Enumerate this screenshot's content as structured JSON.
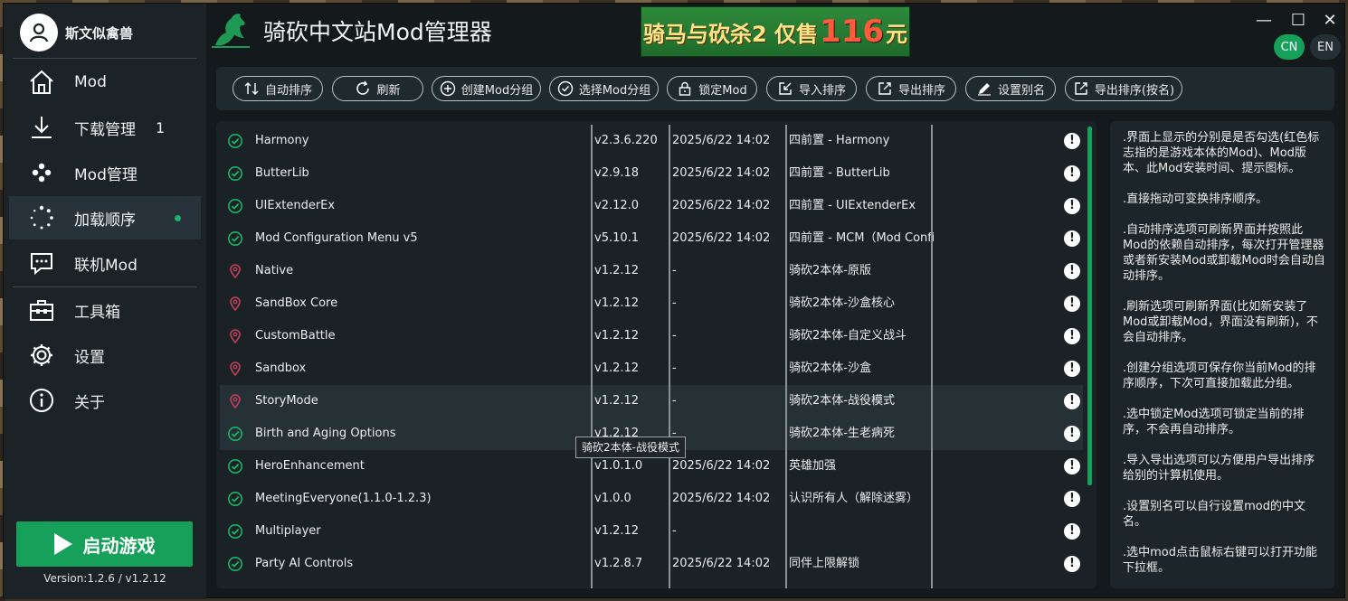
{
  "user": {
    "name": "斯文似禽兽"
  },
  "app": {
    "title": "骑砍中文站Mod管理器",
    "version": "Version:1.2.6 / v1.2.12"
  },
  "banner": {
    "prefix": "骑马与砍杀2 仅售",
    "price": "116",
    "suffix": " 元"
  },
  "window_controls": {
    "minimize": "—",
    "maximize": "☐",
    "close": "✕"
  },
  "language": {
    "cn": "CN",
    "en": "EN",
    "selected": "CN"
  },
  "nav": [
    {
      "label": "Mod",
      "icon": "home-icon"
    },
    {
      "label": "下载管理",
      "count": "1",
      "icon": "download-icon"
    },
    {
      "label": "Mod管理",
      "icon": "dots-icon"
    },
    {
      "label": "加载顺序",
      "icon": "loading-icon",
      "active": true
    },
    {
      "label": "联机Mod",
      "icon": "chat-icon"
    },
    {
      "label": "工具箱",
      "icon": "toolbox-icon"
    },
    {
      "label": "设置",
      "icon": "gear-icon"
    },
    {
      "label": "关于",
      "icon": "info-icon"
    }
  ],
  "launch": {
    "label": "启动游戏"
  },
  "toolbar": [
    {
      "label": "自动排序",
      "icon": "sort-icon"
    },
    {
      "label": "刷新",
      "icon": "refresh-icon"
    },
    {
      "label": "创建Mod分组",
      "icon": "plus-circle-icon"
    },
    {
      "label": "选择Mod分组",
      "icon": "check-circle-icon"
    },
    {
      "label": "锁定Mod",
      "icon": "lock-icon"
    },
    {
      "label": "导入排序",
      "icon": "import-icon"
    },
    {
      "label": "导出排序",
      "icon": "export-icon"
    },
    {
      "label": "设置别名",
      "icon": "pencil-icon"
    },
    {
      "label": "导出排序(按名)",
      "icon": "export-icon"
    }
  ],
  "mods": [
    {
      "name": "Harmony",
      "version": "v2.3.6.220",
      "time": "2025/6/22 14:02",
      "desc": "四前置 - Harmony",
      "type": "check"
    },
    {
      "name": "ButterLib",
      "version": "v2.9.18",
      "time": "2025/6/22 14:02",
      "desc": "四前置 - ButterLib",
      "type": "check"
    },
    {
      "name": "UIExtenderEx",
      "version": "v2.12.0",
      "time": "2025/6/22 14:02",
      "desc": "四前置 - UIExtenderEx",
      "type": "check"
    },
    {
      "name": "Mod Configuration Menu v5",
      "version": "v5.10.1",
      "time": "2025/6/22 14:02",
      "desc": "四前置 - MCM（Mod Config",
      "type": "check"
    },
    {
      "name": "Native",
      "version": "v1.2.12",
      "time": "-",
      "desc": "骑砍2本体-原版",
      "type": "pin"
    },
    {
      "name": "SandBox Core",
      "version": "v1.2.12",
      "time": "-",
      "desc": "骑砍2本体-沙盒核心",
      "type": "pin"
    },
    {
      "name": "CustomBattle",
      "version": "v1.2.12",
      "time": "-",
      "desc": "骑砍2本体-自定义战斗",
      "type": "pin"
    },
    {
      "name": "Sandbox",
      "version": "v1.2.12",
      "time": "-",
      "desc": "骑砍2本体-沙盒",
      "type": "pin"
    },
    {
      "name": "StoryMode",
      "version": "v1.2.12",
      "time": "-",
      "desc": "骑砍2本体-战役模式",
      "type": "pin",
      "highlight": true
    },
    {
      "name": "Birth and Aging Options",
      "version": "v1.2.12",
      "time": "-",
      "desc": "骑砍2本体-生老病死",
      "type": "check",
      "highlight": true
    },
    {
      "name": "HeroEnhancement",
      "version": "v1.0.1.0",
      "time": "2025/6/22 14:02",
      "desc": "英雄加强",
      "type": "check"
    },
    {
      "name": "MeetingEveryone(1.1.0-1.2.3)",
      "version": "v1.0.0",
      "time": "2025/6/22 14:02",
      "desc": "认识所有人（解除迷雾）",
      "type": "check"
    },
    {
      "name": "Multiplayer",
      "version": "v1.2.12",
      "time": "-",
      "desc": "",
      "type": "check"
    },
    {
      "name": "Party AI Controls",
      "version": "v1.2.8.7",
      "time": "2025/6/22 14:02",
      "desc": "同伴上限解锁",
      "type": "check"
    }
  ],
  "tooltip": "骑砍2本体-战役模式",
  "colors": {
    "accent": "#17a05a",
    "pin": "#c0405a"
  },
  "help": [
    ".界面上显示的分别是是否勾选(红色标志指的是游戏本体的Mod)、Mod版本、此Mod安装时间、提示图标。",
    ".直接拖动可变换排序顺序。",
    ".自动排序选项可刷新界面并按照此Mod的依赖自动排序，每次打开管理器或者新安装Mod或卸载Mod时会自动自动排序。",
    ".刷新选项可刷新界面(比如新安装了Mod或卸载Mod，界面没有刷新)，不会自动排序。",
    ".创建分组选项可保存你当前Mod的排序顺序，下次可直接加载此分组。",
    ".选中锁定Mod选项可锁定当前的排序，不会再自动排序。",
    ".导入导出选项可以方便用户导出排序给别的计算机使用。",
    ".设置别名可以自行设置mod的中文名。",
    ".选中mod点击鼠标右键可以打开功能下拉框。"
  ]
}
